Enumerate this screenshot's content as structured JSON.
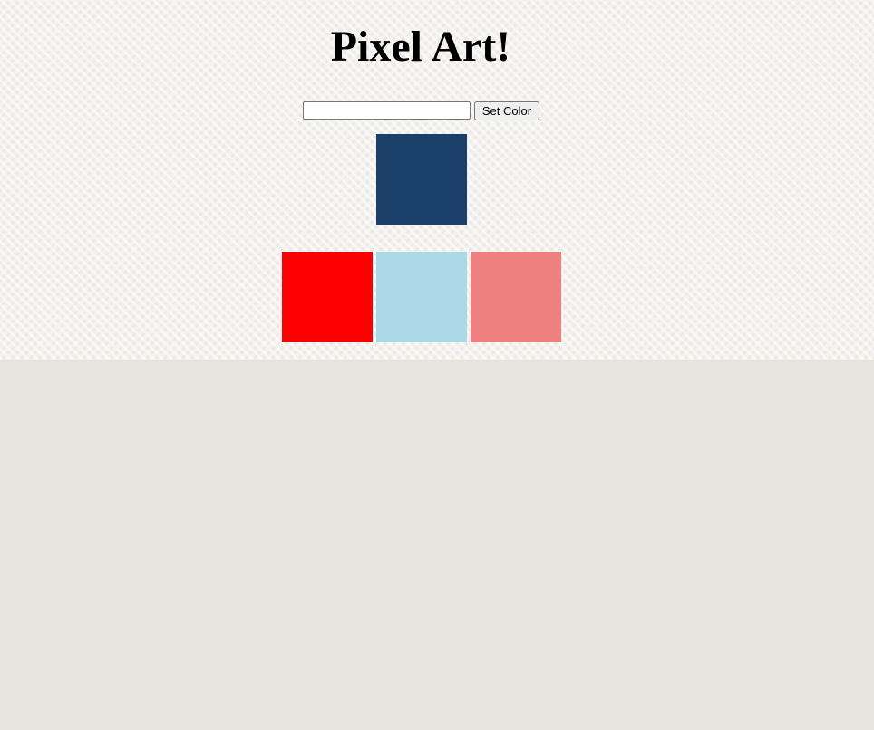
{
  "page": {
    "title": "Pixel Art!"
  },
  "controls": {
    "color_input_value": "",
    "color_input_placeholder": "",
    "set_color_label": "Set Color"
  },
  "brush": {
    "color": "#1a4069"
  },
  "palette": [
    {
      "name": "red",
      "color": "#ff0000"
    },
    {
      "name": "lightblue",
      "color": "#add8e6"
    },
    {
      "name": "lightcoral",
      "color": "#f08080"
    }
  ]
}
